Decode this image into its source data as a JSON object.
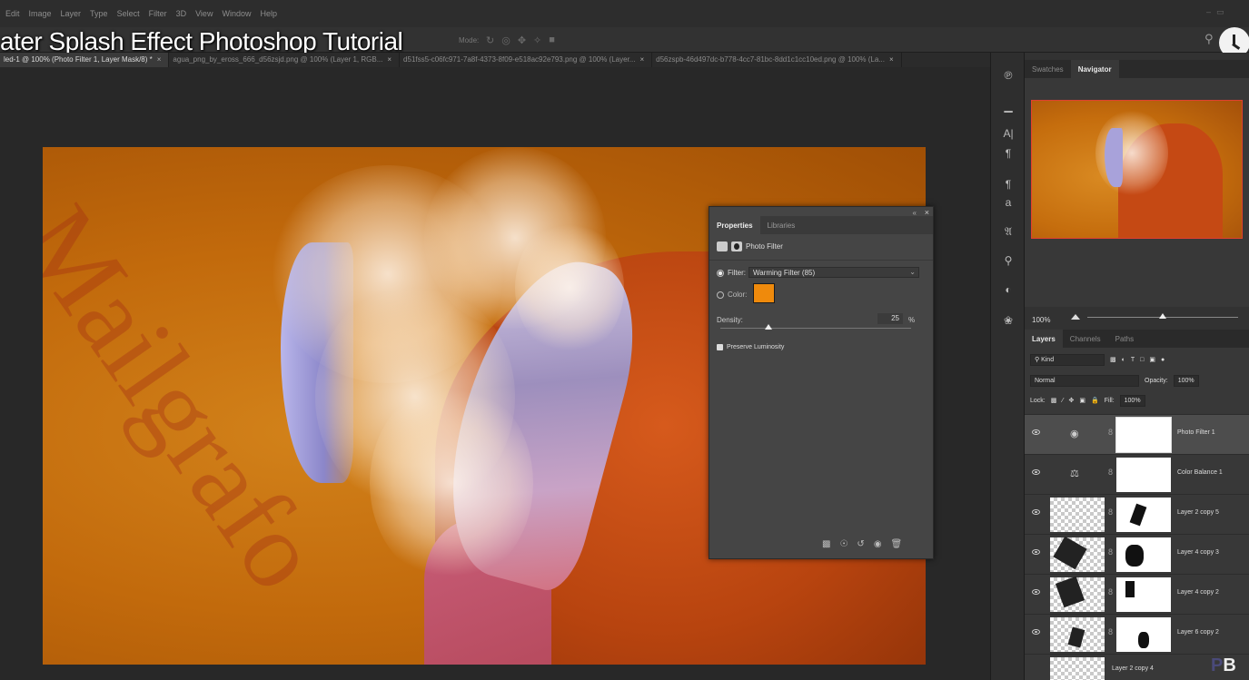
{
  "video_title": "ater Splash Effect Photoshop Tutorial",
  "menu": [
    "Edit",
    "Image",
    "Layer",
    "Type",
    "Select",
    "Filter",
    "3D",
    "View",
    "Window",
    "Help"
  ],
  "options_bar": {
    "mode_text": "Mode:"
  },
  "doc_tabs": [
    {
      "label": "led-1 @ 100% (Photo Filter 1, Layer Mask/8) *",
      "active": true
    },
    {
      "label": "agua_png_by_eross_666_d56zsjd.png @ 100% (Layer 1, RGB...",
      "active": false
    },
    {
      "label": "d51fss5-c06fc971-7a8f-4373-8f09-e518ac92e793.png @ 100% (Layer...",
      "active": false
    },
    {
      "label": "d56zspb-46d497dc-b778-4cc7-81bc-8dd1c1cc10ed.png @ 100% (La...",
      "active": false
    }
  ],
  "watermark": "Mailgrafo",
  "properties": {
    "tabs": [
      "Properties",
      "Libraries"
    ],
    "header": "Photo Filter",
    "filter_label": "Filter:",
    "filter_value": "Warming Filter (85)",
    "color_label": "Color:",
    "color_value": "#ef8a0c",
    "density_label": "Density:",
    "density_value": "25",
    "density_unit": "%",
    "density_fraction": 0.25,
    "preserve_label": "Preserve Luminosity"
  },
  "navigator": {
    "tabs": [
      "Swatches",
      "Navigator"
    ],
    "zoom": "100%"
  },
  "layers_panel": {
    "tabs": [
      "Layers",
      "Channels",
      "Paths"
    ],
    "kind_label": "Kind",
    "blend_mode": "Normal",
    "opacity_label": "Opacity:",
    "opacity_value": "100%",
    "lock_label": "Lock:",
    "fill_label": "Fill:",
    "fill_value": "100%",
    "layers": [
      {
        "name": "Photo Filter 1",
        "type": "adjustment",
        "icon": "photo-filter-icon"
      },
      {
        "name": "Color Balance 1",
        "type": "adjustment",
        "icon": "color-balance-icon"
      },
      {
        "name": "Layer 2 copy 5",
        "type": "pixel"
      },
      {
        "name": "Layer 4 copy 3",
        "type": "pixel"
      },
      {
        "name": "Layer 4 copy 2",
        "type": "pixel"
      },
      {
        "name": "Layer 6 copy 2",
        "type": "pixel"
      },
      {
        "name": "Layer 2 copy 4",
        "type": "pixel"
      }
    ]
  },
  "logo": {
    "left": "P",
    "right": "B"
  }
}
